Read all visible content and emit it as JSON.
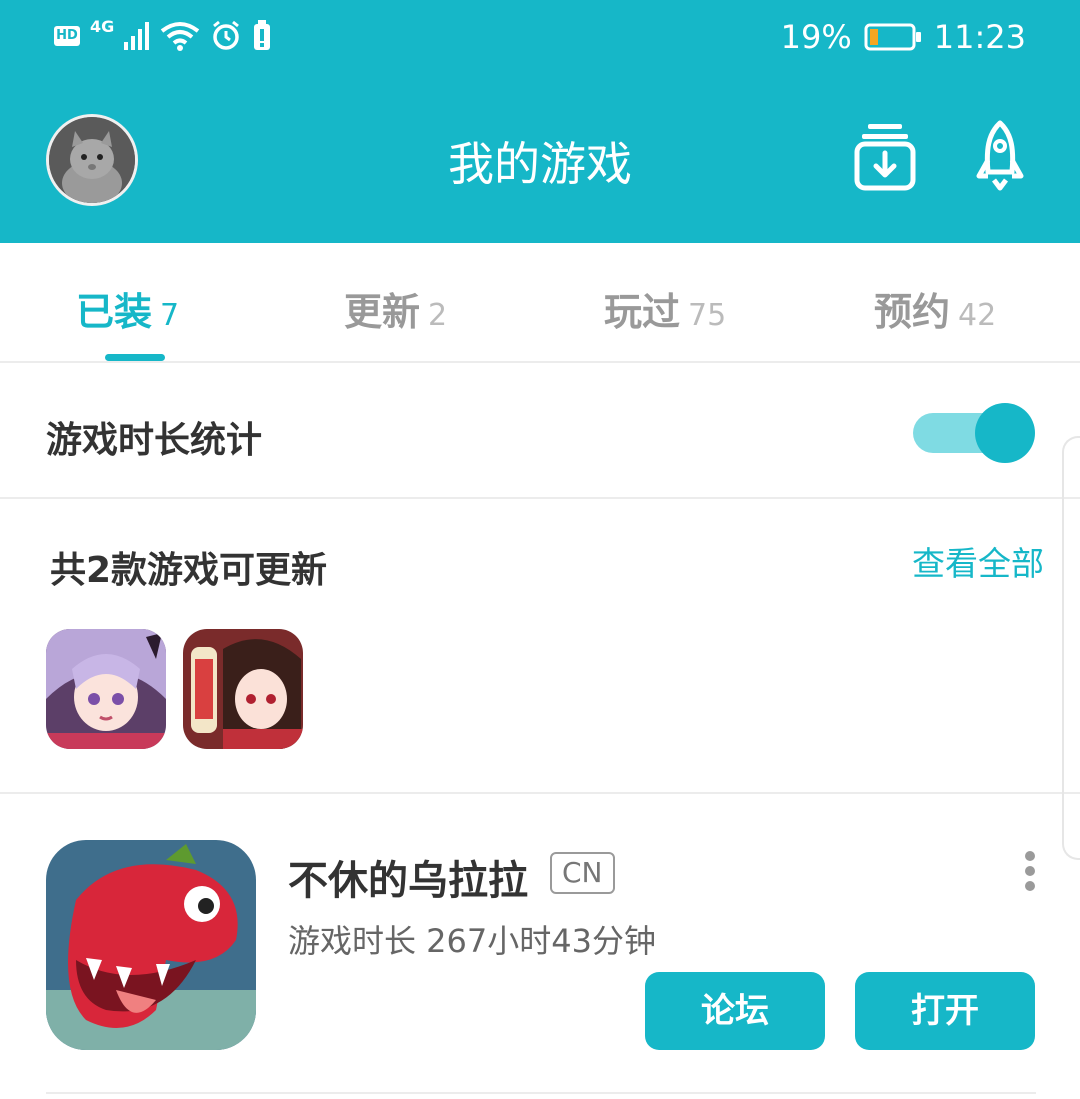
{
  "status_bar": {
    "network_badge": "HD",
    "network_type": "4G",
    "battery_percent": "19%",
    "time": "11:23"
  },
  "header": {
    "title": "我的游戏"
  },
  "tabs": [
    {
      "label": "已装",
      "count": "7",
      "active": true
    },
    {
      "label": "更新",
      "count": "2",
      "active": false
    },
    {
      "label": "玩过",
      "count": "75",
      "active": false
    },
    {
      "label": "预约",
      "count": "42",
      "active": false
    }
  ],
  "play_time_stats": {
    "label": "游戏时长统计",
    "enabled": true
  },
  "updates": {
    "title": "共2款游戏可更新",
    "view_all": "查看全部"
  },
  "game": {
    "name": "不休的乌拉拉",
    "tag": "CN",
    "play_time": "游戏时长 267小时43分钟",
    "forum_button": "论坛",
    "open_button": "打开"
  },
  "colors": {
    "accent": "#16b7c8",
    "toggle_track": "#7fdbe3"
  }
}
